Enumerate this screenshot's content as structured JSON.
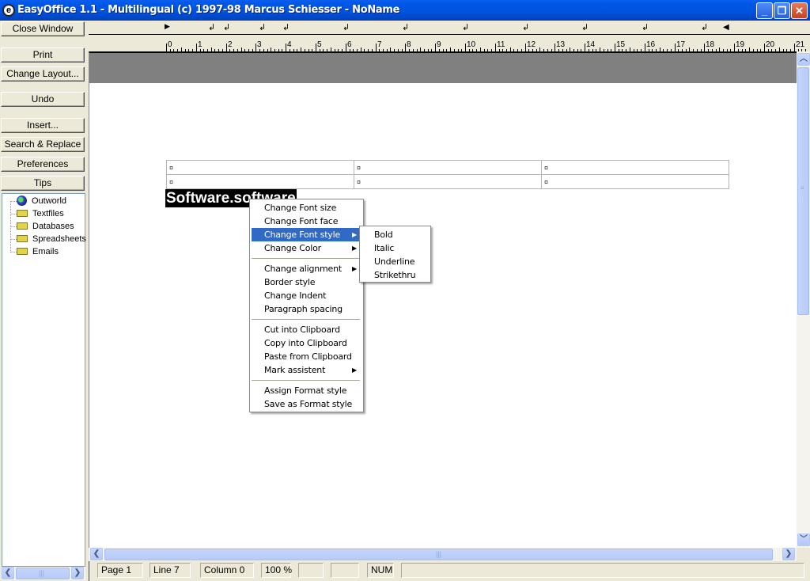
{
  "window": {
    "title": "EasyOffice 1.1 - Multilingual (c) 1997-98 Marcus Schiesser - NoName",
    "app_icon": "e",
    "controls": {
      "minimize": "_",
      "restore": "❐",
      "close": "✕"
    }
  },
  "sidebar": {
    "buttons": [
      {
        "label": "Close Window",
        "name": "close-window-button"
      },
      {
        "label": "Print",
        "name": "print-button"
      },
      {
        "label": "Change Layout...",
        "name": "change-layout-button"
      },
      {
        "label": "Undo",
        "name": "undo-button"
      },
      {
        "label": "Insert...",
        "name": "insert-button"
      },
      {
        "label": "Search & Replace",
        "name": "search-replace-button"
      },
      {
        "label": "Preferences",
        "name": "preferences-button"
      },
      {
        "label": "Tips",
        "name": "tips-button"
      }
    ],
    "tree": [
      {
        "label": "Outworld",
        "icon": "globe-icon"
      },
      {
        "label": "Textfiles",
        "icon": "folder-icon"
      },
      {
        "label": "Databases",
        "icon": "folder-icon"
      },
      {
        "label": "Spreadsheets",
        "icon": "folder-icon"
      },
      {
        "label": "Emails",
        "icon": "folder-icon"
      }
    ]
  },
  "ruler": {
    "numbers": [
      "0",
      "1",
      "2",
      "3",
      "4",
      "5",
      "6",
      "7",
      "8",
      "9",
      "10",
      "11",
      "12",
      "13",
      "14",
      "15",
      "16",
      "17",
      "18",
      "19",
      "20",
      "21"
    ],
    "tab_glyph": "↲",
    "left_indent_glyph": "▶",
    "right_indent_glyph": "◀"
  },
  "document": {
    "table": [
      [
        "¤",
        "¤",
        "¤"
      ],
      [
        "¤",
        "¤",
        "¤"
      ]
    ],
    "selected_text": "Software.software"
  },
  "context_menu": {
    "groups": [
      [
        {
          "label": "Change Font size",
          "submenu": false
        },
        {
          "label": "Change Font face",
          "submenu": false
        },
        {
          "label": "Change Font style",
          "submenu": true,
          "highlighted": true
        },
        {
          "label": "Change Color",
          "submenu": true
        }
      ],
      [
        {
          "label": "Change alignment",
          "submenu": true
        },
        {
          "label": "Border style",
          "submenu": false
        },
        {
          "label": "Change Indent",
          "submenu": false
        },
        {
          "label": "Paragraph spacing",
          "submenu": false
        }
      ],
      [
        {
          "label": "Cut into Clipboard",
          "submenu": false
        },
        {
          "label": "Copy into Clipboard",
          "submenu": false
        },
        {
          "label": "Paste from Clipboard",
          "submenu": false
        },
        {
          "label": "Mark assistent",
          "submenu": true
        }
      ],
      [
        {
          "label": "Assign Format style",
          "submenu": false
        },
        {
          "label": "Save as Format style",
          "submenu": false
        }
      ]
    ],
    "submenu_arrow": "▶"
  },
  "font_style_submenu": {
    "items": [
      "Bold",
      "Italic",
      "Underline",
      "Strikethru"
    ]
  },
  "statusbar": {
    "page": "Page  1",
    "line": "Line  7",
    "column": "Column  0",
    "zoom": "100 %",
    "empty1": "",
    "empty2": "",
    "num": "NUM",
    "empty3": ""
  },
  "scroll": {
    "up": "︿",
    "down": "﹀",
    "left": "❮",
    "right": "❯",
    "grip": "|||"
  },
  "colors": {
    "titlebar": "#0054e3",
    "menu_highlight": "#316ac5",
    "header_band": "#808080",
    "scrollbar": "#c5d5fb"
  }
}
